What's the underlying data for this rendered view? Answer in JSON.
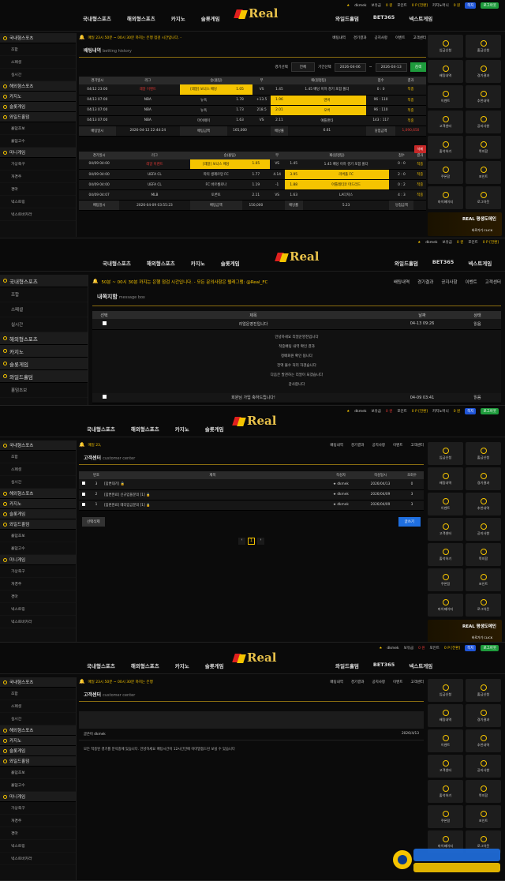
{
  "logo": {
    "text": "Real"
  },
  "nav": {
    "left": [
      "국내형스포츠",
      "해외형스포츠",
      "카지노",
      "슬롯게임"
    ],
    "right": [
      "와일드홀덤",
      "BET365",
      "넥스트게임"
    ]
  },
  "user": {
    "name": "dkmek",
    "balance_label": "보유금",
    "balance": "0 원",
    "point_label": "포인트",
    "point": "0 P [전환]",
    "casino_label": "카지노머니",
    "casino": "0 원",
    "btn_msg": "쪽지",
    "btn_logout": "로그아웃"
  },
  "sidebar": {
    "cat1": "국내형스포츠",
    "cat1_subs": [
      "조합",
      "스페셜",
      "실시간"
    ],
    "cat2": "해외형스포츠",
    "cat3": "카지노",
    "cat4": "슬롯게임",
    "cat5": "와일드홀덤",
    "cat5_subs": [
      "홀덤초보",
      "홀덤고수"
    ],
    "cat6": "미니게임",
    "cat6_subs": [
      "가상축구",
      "개경주",
      "경마",
      "넥스트링",
      "넥스트바카라",
      "넥스트사다리"
    ]
  },
  "toplinks": [
    "배팅내역",
    "경기결과",
    "공지사항",
    "이벤트",
    "고객센터"
  ],
  "notices": {
    "n1": "매일 23시 50분 ~ 00시 30분 까지는 은행 점검 시간입니다. -",
    "n2": "50분 ~ 00시 30분 까지는 은행 점검 시간입니다. - 모든 문의사항은 텔레그램: @Real_FC",
    "n3": "매일 23,",
    "n4": "매일 23시 50분 ~ 00시 30분 까지는 은행"
  },
  "bet": {
    "title": "배팅내역",
    "title_en": "betting history",
    "filter_label": "경기선택",
    "filter_value": "전체",
    "period_label": "기간선택",
    "date_from": "2026-04-06",
    "date_to": "2026-04-13",
    "search": "검색",
    "headers": [
      "경기일시",
      "리그",
      "승(홈팀)",
      "무",
      "패(원정팀)",
      "점수",
      "결과"
    ],
    "slip1": [
      {
        "time": "04/12 23:00",
        "league": "레알 이벤트",
        "home": "[레알] 보너스 배당",
        "hodd": "1.05",
        "draw": "VS",
        "aodd": "1.45",
        "away": "1.45 배당 이하 경기 포함 폴더",
        "score": "0 : 0",
        "result": "적중"
      },
      {
        "time": "04/13 07:00",
        "league": "NBA",
        "home": "뉴욕",
        "hodd": "1.78",
        "draw": "+13.5",
        "aodd": "1.96",
        "away": "덴버",
        "score": "96 : 110",
        "result": "적중"
      },
      {
        "time": "04/13 07:00",
        "league": "NBA",
        "home": "뉴욕",
        "hodd": "1.73",
        "draw": "218.5",
        "aodd": "2.01",
        "away": "오버",
        "score": "96 : 110",
        "result": "적중"
      },
      {
        "time": "04/13 07:00",
        "league": "NBA",
        "home": "마이애미",
        "hodd": "1.63",
        "draw": "VS",
        "aodd": "2.11",
        "away": "애틀랜타",
        "score": "143 : 117",
        "result": "적중"
      }
    ],
    "slip1_summary": {
      "date_label": "배팅일시",
      "date": "2026-04-12 22:44:24",
      "amt_label": "배팅금액",
      "amt": "165,000",
      "odds_label": "배당률",
      "odds": "6.61",
      "win_label": "당첨금액",
      "win": "1,090,650"
    },
    "slip2": [
      {
        "time": "04/09 04:00",
        "league": "레알 이벤트",
        "home": "[레알] 보너스 배당",
        "hodd": "1.05",
        "draw": "VS",
        "aodd": "1.45",
        "away": "1.45 배당 이하 경기 포함 폴더",
        "score": "0 : 0",
        "result": "적중"
      },
      {
        "time": "04/09 04:00",
        "league": "UEFA CL",
        "home": "파리 생제르망 FC",
        "hodd": "1.77",
        "draw": "4.14",
        "aodd": "3.95",
        "away": "리버풀 FC",
        "score": "2 : 0",
        "result": "적중"
      },
      {
        "time": "04/09 04:00",
        "league": "UEFA CL",
        "home": "FC 바르셀로나",
        "hodd": "1.19",
        "draw": "-1",
        "aodd": "1.88",
        "away": "아틀레티코 마드리드",
        "score": "0 : 2",
        "result": "적중"
      },
      {
        "time": "04/09 04:07",
        "league": "MLB",
        "home": "토론토",
        "hodd": "2.11",
        "draw": "VS",
        "aodd": "1.63",
        "away": "LA다저스",
        "score": "4 : 3",
        "result": "적중"
      }
    ],
    "slip2_summary": {
      "date_label": "배팅일시",
      "date": "2026-04-09 03:55:23",
      "amt_label": "배팅금액",
      "amt": "150,000",
      "odds_label": "배당률",
      "odds": "5.23",
      "win_label": "당첨금액",
      "win": ""
    },
    "delete": "삭제"
  },
  "msg": {
    "title": "내쪽지함",
    "title_en": "message box",
    "headers": [
      "선택",
      "제목",
      "날짜",
      "상태"
    ],
    "row1": {
      "title": "리얼운영진입니다",
      "date": "04-13 09:26",
      "status": "읽음"
    },
    "body": [
      "안녕하세요 리얼운영진입니다",
      "적중배팅 내역 확인 결과",
      "정배회원 확인 됩니다",
      "전액 몰수 처리 하겠습니다",
      "다음은 발견하는 리얼이 되겠습니다",
      "감사합니다"
    ],
    "row2": {
      "title": "회원님 가입 축하드립니다!",
      "date": "04-09 03:41",
      "status": "읽음"
    }
  },
  "cs": {
    "title": "고객센터",
    "title_en": "customer center",
    "headers": [
      "번호",
      "제목",
      "작성자",
      "작성일시",
      "조회수"
    ],
    "rows": [
      {
        "no": "3",
        "title": "[답변대기] 🔒",
        "author": "dkmek",
        "date": "2026/04/13",
        "views": "0"
      },
      {
        "no": "2",
        "title": "[답변완료] 신규입플문의 [1] 🔒",
        "author": "dkmek",
        "date": "2026/04/09",
        "views": "3"
      },
      {
        "no": "1",
        "title": "[답변완료] 테더입금문의 [1] 🔒",
        "author": "dkmek",
        "date": "2026/04/09",
        "views": "3"
      }
    ],
    "btn_delete": "선택삭제",
    "btn_write": "글쓰기",
    "page": "1"
  },
  "cs2": {
    "title": "고객센터",
    "title_en": "customer center",
    "author_label": "글쓴이",
    "author": "dkmek",
    "date": "2026/4/13",
    "body": "모든 적중된 경기를 분석중에 있습니다. 안녕하세요 배팅시간이 12시간안에 이미말씀드린 보실 수 있습니다"
  },
  "rsb": [
    "입금신청",
    "출금신청",
    "배팅내역",
    "경기결과",
    "이벤트",
    "추천내역",
    "고객센터",
    "공지사항",
    "출석하기",
    "쪽지함",
    "쿠폰함",
    "포인트",
    "마이페이지",
    "로그아웃"
  ],
  "banner": {
    "t1": "REAL 평생도메인",
    "t2": "바로가기 CLICK"
  },
  "colors": {
    "accent": "#f5c400",
    "bg": "#0b0b0b",
    "danger": "#c62828"
  }
}
